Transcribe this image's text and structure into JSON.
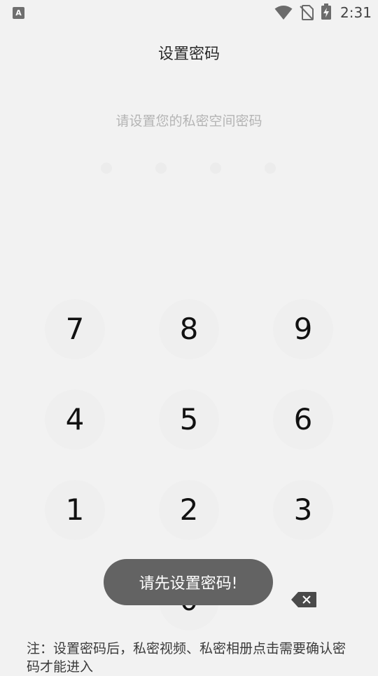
{
  "status_bar": {
    "app_icon": "A",
    "icons": [
      "wifi-icon",
      "no-sim-icon",
      "battery-charging-icon"
    ],
    "time": "2:31"
  },
  "header": {
    "title": "设置密码"
  },
  "instruction": "请设置您的私密空间密码",
  "pin": {
    "length": 4,
    "entered": 0
  },
  "keypad": {
    "keys": [
      "7",
      "8",
      "9",
      "4",
      "5",
      "6",
      "1",
      "2",
      "3",
      "0"
    ],
    "delete_icon": "backspace-icon"
  },
  "toast": "请先设置密码!",
  "note": "注：设置密码后，私密视频、私密相册点击需要确认密码才能进入",
  "colors": {
    "background": "#f2f2f2",
    "key_background": "#efefef",
    "toast_background": "#636363",
    "instruction_text": "#b4b4b4"
  }
}
